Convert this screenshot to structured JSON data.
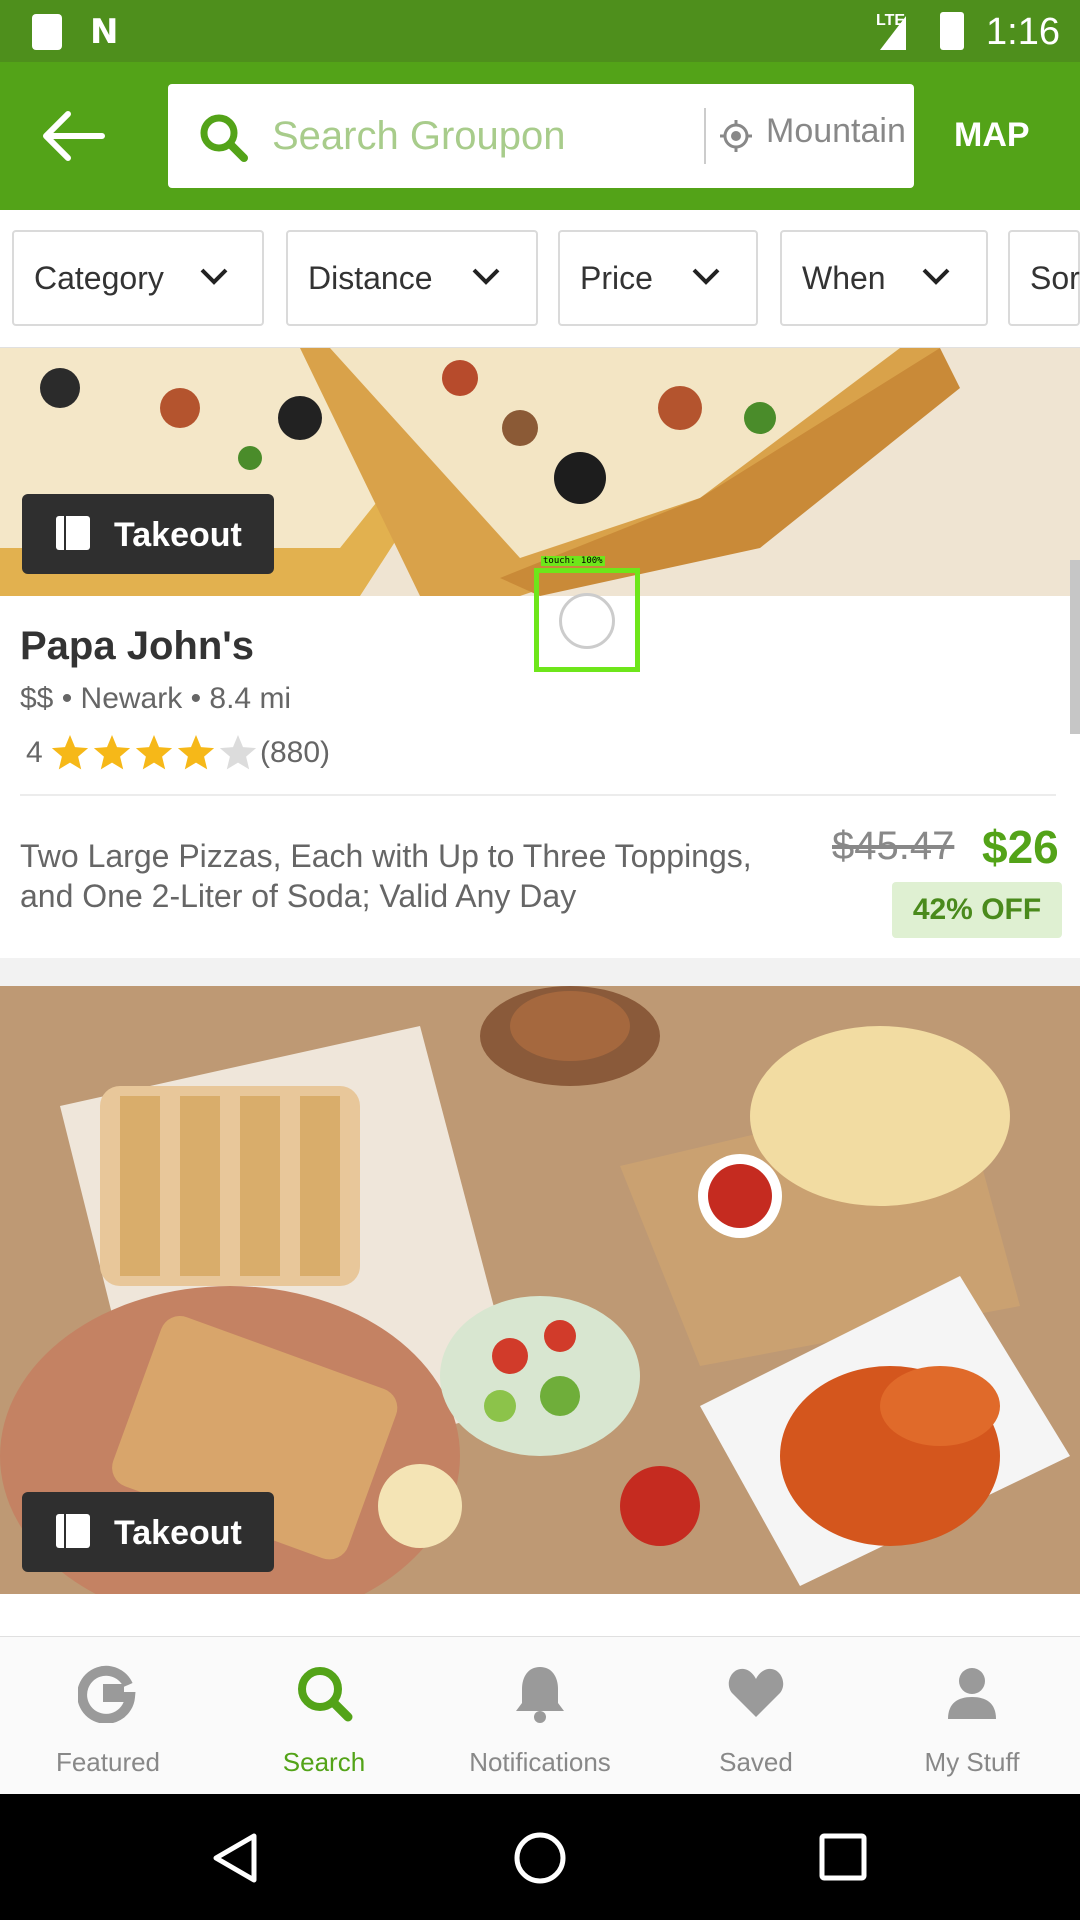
{
  "status_bar": {
    "time": "1:16",
    "network": "LTE"
  },
  "toolbar": {
    "search_placeholder": "Search Groupon",
    "location": "Mountain",
    "map_label": "MAP"
  },
  "filters": [
    {
      "label": "Category"
    },
    {
      "label": "Distance"
    },
    {
      "label": "Price"
    },
    {
      "label": "When"
    },
    {
      "label": "Sort"
    }
  ],
  "deals": [
    {
      "badge": "Takeout",
      "title": "Papa John's",
      "meta": "$$ • Newark • 8.4 mi",
      "rating_value": "4",
      "rating_count": "(880)",
      "stars_filled": 4,
      "stars_total": 5,
      "description": "Two Large Pizzas, Each with Up to Three Toppings, and One 2-Liter of Soda; Valid Any Day",
      "original_price": "$45.47",
      "price": "$26",
      "discount": "42% OFF"
    },
    {
      "badge": "Takeout"
    }
  ],
  "touch_indicator": {
    "label": "touch: 100%"
  },
  "bottom_nav": [
    {
      "label": "Featured",
      "icon": "groupon-g-icon",
      "active": false
    },
    {
      "label": "Search",
      "icon": "search-icon",
      "active": true
    },
    {
      "label": "Notifications",
      "icon": "bell-icon",
      "active": false
    },
    {
      "label": "Saved",
      "icon": "heart-icon",
      "active": false
    },
    {
      "label": "My Stuff",
      "icon": "person-icon",
      "active": false
    }
  ],
  "colors": {
    "brand_green": "#53a318",
    "status_bar": "#4e8f1c",
    "star_yellow": "#f6b818",
    "discount_bg": "#dff0d2"
  }
}
